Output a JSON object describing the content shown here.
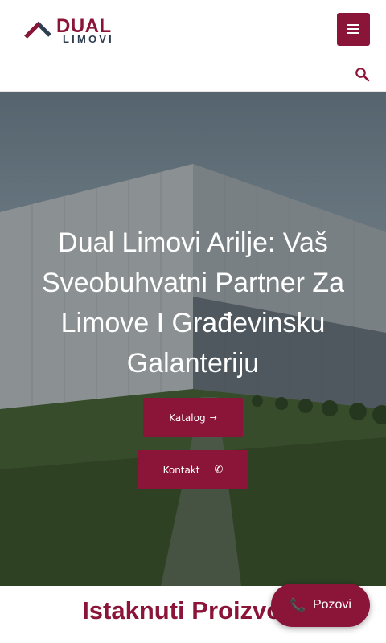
{
  "header": {
    "logo_top": "DUAL",
    "logo_bottom": "LIMOVI",
    "menu_icon": "hamburger-menu-icon",
    "search_icon": "search-icon"
  },
  "hero": {
    "title": "Dual Limovi Arilje: Vaš Sveobuhvatni Partner Za Limove I Građevinsku Galanteriju",
    "katalog_label": "Katalog",
    "katalog_icon": "→",
    "kontakt_label": "Kontakt",
    "kontakt_icon": "✆"
  },
  "section": {
    "title": "Istaknuti Proizvodi"
  },
  "floating": {
    "call_label": "Pozovi",
    "call_icon": "📞"
  },
  "colors": {
    "brand": "#8b1538",
    "text_dark": "#2c3e50",
    "white": "#ffffff"
  }
}
